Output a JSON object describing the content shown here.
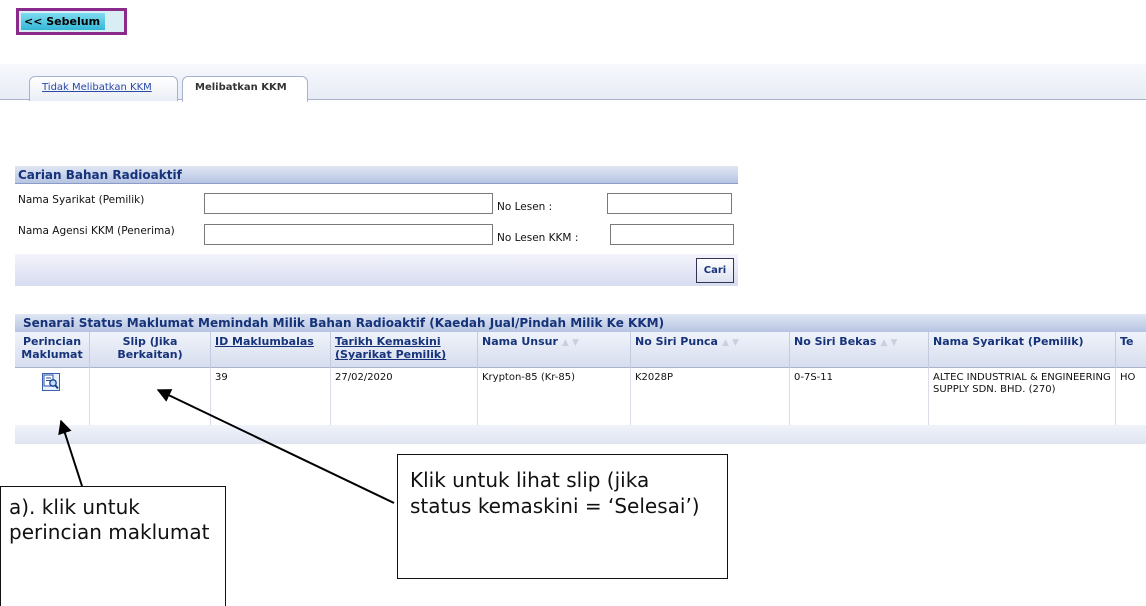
{
  "nav": {
    "back_label": "<< Sebelum"
  },
  "tabs": [
    {
      "label": "Tidak Melibatkan KKM",
      "active": false
    },
    {
      "label": "Melibatkan KKM",
      "active": true
    }
  ],
  "search": {
    "title": "Carian Bahan Radioaktif",
    "company_label": "Nama Syarikat (Pemilik)",
    "company_value": "",
    "agency_label": "Nama Agensi KKM (Penerima)",
    "agency_value": "",
    "license_label": "No Lesen     :",
    "license_value": "",
    "kkm_license_label": "No Lesen KKM :",
    "kkm_license_value": "",
    "search_button": "Cari"
  },
  "list": {
    "title": "Senarai Status Maklumat Memindah Milik Bahan Radioaktif (Kaedah Jual/Pindah Milik Ke KKM)",
    "headers": {
      "detail": "Perincian Maklumat",
      "slip": "Slip (Jika Berkaitan)",
      "id": "ID Maklumbalas",
      "date": "Tarikh Kemaskini (Syarikat Pemilik)",
      "element": "Nama Unsur",
      "source_serial": "No Siri Punca",
      "container_serial": "No Siri Bekas",
      "company": "Nama Syarikat (Pemilik)",
      "extra": "Te"
    },
    "rows": [
      {
        "id": "39",
        "date": "27/02/2020",
        "element": "Krypton-85 (Kr-85)",
        "source_serial": "K2028P",
        "container_serial": "0-7S-11",
        "company": "ALTEC INDUSTRIAL & ENGINEERING SUPPLY SDN. BHD. (270)",
        "extra": "HO"
      }
    ]
  },
  "annotations": {
    "slip_note": "Klik untuk lihat slip (jika status kemaskini = ‘Selesai’)",
    "detail_note": "a). klik untuk perincian maklumat"
  },
  "colors": {
    "header_blue": "#16337a",
    "tab_link": "#2a4aa8",
    "back_border": "#8a2a8a"
  }
}
